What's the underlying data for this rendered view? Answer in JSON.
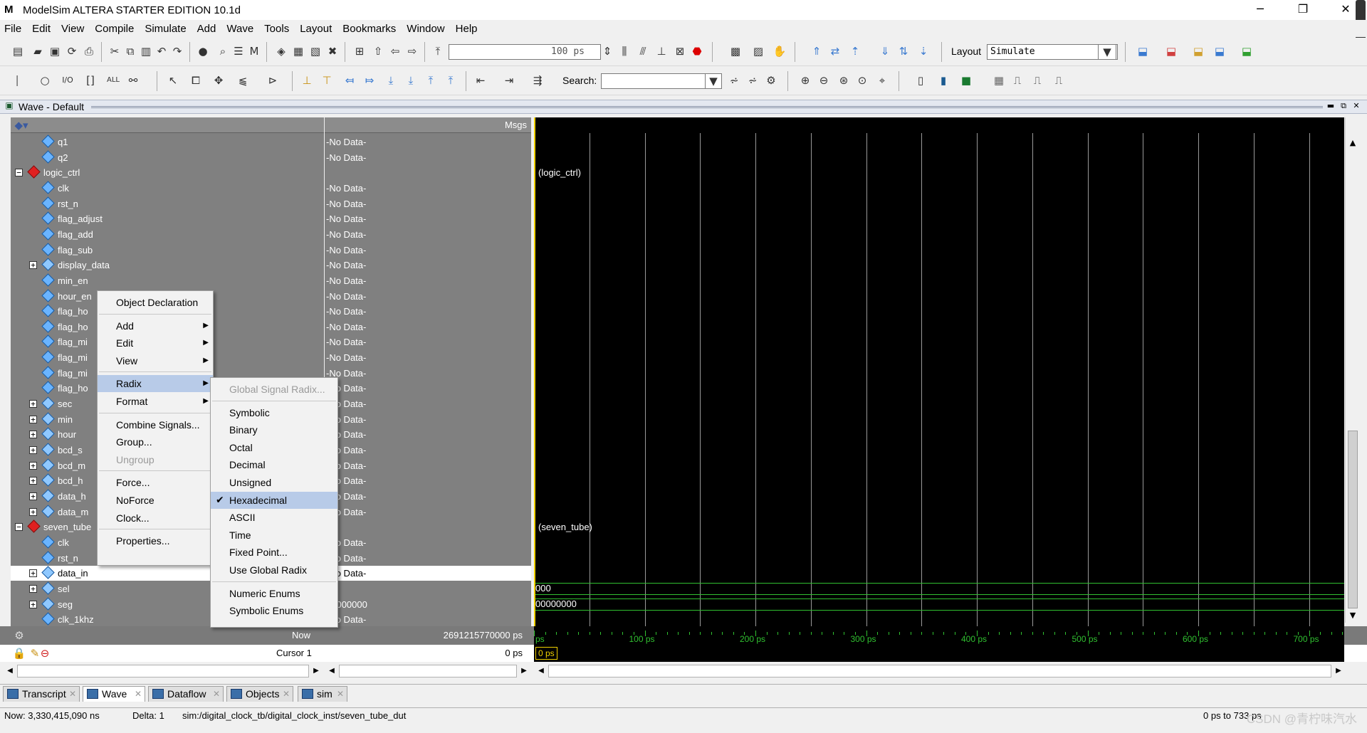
{
  "window": {
    "title": "ModelSim ALTERA STARTER EDITION 10.1d",
    "logo_glyph": "M",
    "minimize_glyph": "─",
    "restore_glyph": "❐",
    "close_glyph": "✕"
  },
  "menu": [
    "File",
    "Edit",
    "View",
    "Compile",
    "Simulate",
    "Add",
    "Wave",
    "Tools",
    "Layout",
    "Bookmarks",
    "Window",
    "Help"
  ],
  "toolbar": {
    "time_step": "100 ps",
    "layout_label": "Layout",
    "layout_value": "Simulate",
    "search_label": "Search:",
    "search_value": ""
  },
  "wave_window": {
    "title": "Wave - Default",
    "msgs_header": "Msgs"
  },
  "signals": [
    {
      "name": "q1",
      "value": "-No Data-",
      "indent": 2,
      "kind": "sig",
      "expand": ""
    },
    {
      "name": "q2",
      "value": "-No Data-",
      "indent": 2,
      "kind": "sig",
      "expand": ""
    },
    {
      "name": "logic_ctrl",
      "value": "",
      "indent": 1,
      "kind": "inst",
      "expand": "−"
    },
    {
      "name": "clk",
      "value": "-No Data-",
      "indent": 2,
      "kind": "sig",
      "expand": ""
    },
    {
      "name": "rst_n",
      "value": "-No Data-",
      "indent": 2,
      "kind": "sig",
      "expand": ""
    },
    {
      "name": "flag_adjust",
      "value": "-No Data-",
      "indent": 2,
      "kind": "sig",
      "expand": ""
    },
    {
      "name": "flag_add",
      "value": "-No Data-",
      "indent": 2,
      "kind": "sig",
      "expand": ""
    },
    {
      "name": "flag_sub",
      "value": "-No Data-",
      "indent": 2,
      "kind": "sig",
      "expand": ""
    },
    {
      "name": "display_data",
      "value": "-No Data-",
      "indent": 2,
      "kind": "bus",
      "expand": "+"
    },
    {
      "name": "min_en",
      "value": "-No Data-",
      "indent": 2,
      "kind": "sig",
      "expand": ""
    },
    {
      "name": "hour_en",
      "value": "-No Data-",
      "indent": 2,
      "kind": "sig",
      "expand": ""
    },
    {
      "name": "flag_ho",
      "value": "-No Data-",
      "indent": 2,
      "kind": "sig",
      "expand": ""
    },
    {
      "name": "flag_ho",
      "value": "-No Data-",
      "indent": 2,
      "kind": "sig",
      "expand": ""
    },
    {
      "name": "flag_mi",
      "value": "-No Data-",
      "indent": 2,
      "kind": "sig",
      "expand": ""
    },
    {
      "name": "flag_mi",
      "value": "-No Data-",
      "indent": 2,
      "kind": "sig",
      "expand": ""
    },
    {
      "name": "flag_mi",
      "value": "-No Data-",
      "indent": 2,
      "kind": "sig",
      "expand": ""
    },
    {
      "name": "flag_ho",
      "value": "-No Data-",
      "indent": 2,
      "kind": "sig",
      "expand": ""
    },
    {
      "name": "sec",
      "value": "-No Data-",
      "indent": 2,
      "kind": "bus",
      "expand": "+"
    },
    {
      "name": "min",
      "value": "-No Data-",
      "indent": 2,
      "kind": "bus",
      "expand": "+"
    },
    {
      "name": "hour",
      "value": "-No Data-",
      "indent": 2,
      "kind": "bus",
      "expand": "+"
    },
    {
      "name": "bcd_s",
      "value": "-No Data-",
      "indent": 2,
      "kind": "bus",
      "expand": "+"
    },
    {
      "name": "bcd_m",
      "value": "-No Data-",
      "indent": 2,
      "kind": "bus",
      "expand": "+"
    },
    {
      "name": "bcd_h",
      "value": "-No Data-",
      "indent": 2,
      "kind": "bus",
      "expand": "+"
    },
    {
      "name": "data_h",
      "value": "-No Data-",
      "indent": 2,
      "kind": "bus",
      "expand": "+"
    },
    {
      "name": "data_m",
      "value": "-No Data-",
      "indent": 2,
      "kind": "bus",
      "expand": "+"
    },
    {
      "name": "seven_tube",
      "value": "",
      "indent": 1,
      "kind": "inst",
      "expand": "−"
    },
    {
      "name": "clk",
      "value": "-No Data-",
      "indent": 2,
      "kind": "sig",
      "expand": ""
    },
    {
      "name": "rst_n",
      "value": "-No Data-",
      "indent": 2,
      "kind": "sig",
      "expand": ""
    },
    {
      "name": "data_in",
      "value": "-No Data-",
      "indent": 2,
      "kind": "bus",
      "expand": "+",
      "selected": true
    },
    {
      "name": "sel",
      "value": "0",
      "indent": 2,
      "kind": "bus",
      "expand": "+"
    },
    {
      "name": "seg",
      "value": "00000000",
      "indent": 2,
      "kind": "bus",
      "expand": "+"
    },
    {
      "name": "clk_1khz",
      "value": "-No Data-",
      "indent": 2,
      "kind": "sig",
      "expand": ""
    }
  ],
  "wave": {
    "group_labels": [
      {
        "text": "(logic_ctrl)",
        "row": 2
      },
      {
        "text": "(seven_tube)",
        "row": 25
      }
    ],
    "bus_values": [
      {
        "text": "000",
        "row": 29
      },
      {
        "text": "00000000",
        "row": 30
      }
    ]
  },
  "status_rows": {
    "now_label": "Now",
    "now_value": "2691215770000 ps",
    "cursor_label": "Cursor 1",
    "cursor_value": "0 ps",
    "cursor_marker": "0 ps",
    "axis_start": "ps"
  },
  "time_axis": [
    "100 ps",
    "200 ps",
    "300 ps",
    "400 ps",
    "500 ps",
    "600 ps",
    "700 ps"
  ],
  "context_menu": {
    "items": [
      {
        "label": "Object Declaration",
        "sub": false
      },
      {
        "sep": true
      },
      {
        "label": "Add",
        "sub": true
      },
      {
        "label": "Edit",
        "sub": true
      },
      {
        "label": "View",
        "sub": true
      },
      {
        "sep": true
      },
      {
        "label": "Radix",
        "sub": true,
        "hl": true
      },
      {
        "label": "Format",
        "sub": true
      },
      {
        "sep": true
      },
      {
        "label": "Combine Signals...",
        "sub": false
      },
      {
        "label": "Group...",
        "sub": false
      },
      {
        "label": "Ungroup",
        "sub": false,
        "dis": true
      },
      {
        "sep": true
      },
      {
        "label": "Force...",
        "sub": false
      },
      {
        "label": "NoForce",
        "sub": false
      },
      {
        "label": "Clock...",
        "sub": false
      },
      {
        "sep": true
      },
      {
        "label": "Properties...",
        "sub": false
      }
    ]
  },
  "radix_menu": {
    "items": [
      {
        "label": "Global Signal Radix...",
        "dis": true
      },
      {
        "sep": true
      },
      {
        "label": "Symbolic"
      },
      {
        "label": "Binary"
      },
      {
        "label": "Octal"
      },
      {
        "label": "Decimal"
      },
      {
        "label": "Unsigned"
      },
      {
        "label": "Hexadecimal",
        "checked": true,
        "hl": true
      },
      {
        "label": "ASCII"
      },
      {
        "label": "Time"
      },
      {
        "label": "Fixed Point..."
      },
      {
        "label": "Use Global Radix"
      },
      {
        "sep": true
      },
      {
        "label": "Numeric Enums"
      },
      {
        "label": "Symbolic Enums"
      }
    ]
  },
  "tabs": [
    "Transcript",
    "Wave",
    "Dataflow",
    "Objects",
    "sim"
  ],
  "statusbar": {
    "now": "Now: 3,330,415,090 ns",
    "delta": "Delta: 1",
    "path": "sim:/digital_clock_tb/digital_clock_inst/seven_tube_dut",
    "range": "0 ps to 733 ps"
  },
  "watermark": "CSDN @青柠味汽水",
  "colors": {
    "wave_bg": "#000000",
    "signal_green": "#30c030",
    "cursor_yellow": "#f0d000",
    "highlight": "#b8cbe8"
  }
}
